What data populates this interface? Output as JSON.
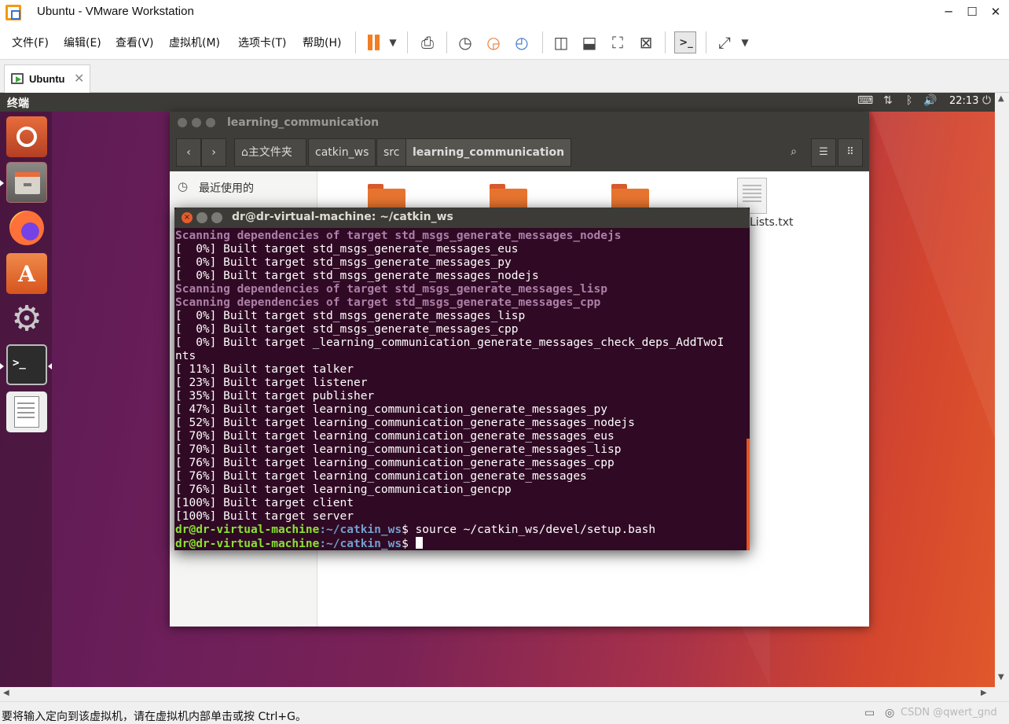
{
  "window": {
    "title": "Ubuntu - VMware Workstation",
    "controls": {
      "minimize": "─",
      "maximize": "☐",
      "close": "✕"
    }
  },
  "menubar": {
    "items": [
      "文件(F)",
      "编辑(E)",
      "查看(V)",
      "虚拟机(M)",
      "选项卡(T)",
      "帮助(H)"
    ]
  },
  "toolbar": {
    "icons": [
      "pause-icon",
      "dropdown-icon",
      "send-ctrl-alt-del-icon",
      "snapshot-icon",
      "revert-snapshot-icon",
      "snapshot-manager-icon",
      "show-library-icon",
      "thumbnail-icon",
      "full-screen-icon",
      "unity-icon",
      "console-view-icon",
      "stretch-icon",
      "dropdown-icon"
    ],
    "accent": "#f07e22"
  },
  "tabs": [
    {
      "label": "Ubuntu",
      "close": "✕"
    }
  ],
  "ubuntu": {
    "topbar": {
      "app_name": "终端",
      "clock": "22:13"
    },
    "launcher": [
      "ubuntu-icon",
      "file-manager-icon",
      "firefox-icon",
      "software-center-icon",
      "system-settings-icon",
      "terminal-icon",
      "text-editor-icon"
    ],
    "nautilus": {
      "title": "learning_communication",
      "breadcrumb": [
        "主文件夹",
        "catkin_ws",
        "src",
        "learning_communication"
      ],
      "sidebar": [
        "最近使用的"
      ],
      "file_label": "Lists.txt"
    },
    "terminal": {
      "title": "dr@dr-virtual-machine: ~/catkin_ws",
      "lines": [
        {
          "type": "scan",
          "text": "Scanning dependencies of target std_msgs_generate_messages_nodejs"
        },
        {
          "type": "out",
          "text": "[  0%] Built target std_msgs_generate_messages_eus"
        },
        {
          "type": "out",
          "text": "[  0%] Built target std_msgs_generate_messages_py"
        },
        {
          "type": "out",
          "text": "[  0%] Built target std_msgs_generate_messages_nodejs"
        },
        {
          "type": "scan",
          "text": "Scanning dependencies of target std_msgs_generate_messages_lisp"
        },
        {
          "type": "scan",
          "text": "Scanning dependencies of target std_msgs_generate_messages_cpp"
        },
        {
          "type": "out",
          "text": "[  0%] Built target std_msgs_generate_messages_lisp"
        },
        {
          "type": "out",
          "text": "[  0%] Built target std_msgs_generate_messages_cpp"
        },
        {
          "type": "out",
          "text": "[  0%] Built target _learning_communication_generate_messages_check_deps_AddTwoI"
        },
        {
          "type": "out",
          "text": "nts"
        },
        {
          "type": "out",
          "text": "[ 11%] Built target talker"
        },
        {
          "type": "out",
          "text": "[ 23%] Built target listener"
        },
        {
          "type": "out",
          "text": "[ 35%] Built target publisher"
        },
        {
          "type": "out",
          "text": "[ 47%] Built target learning_communication_generate_messages_py"
        },
        {
          "type": "out",
          "text": "[ 52%] Built target learning_communication_generate_messages_nodejs"
        },
        {
          "type": "out",
          "text": "[ 70%] Built target learning_communication_generate_messages_eus"
        },
        {
          "type": "out",
          "text": "[ 70%] Built target learning_communication_generate_messages_lisp"
        },
        {
          "type": "out",
          "text": "[ 76%] Built target learning_communication_generate_messages_cpp"
        },
        {
          "type": "out",
          "text": "[ 76%] Built target learning_communication_generate_messages"
        },
        {
          "type": "out",
          "text": "[ 76%] Built target learning_communication_gencpp"
        },
        {
          "type": "out",
          "text": "[100%] Built target client"
        },
        {
          "type": "out",
          "text": "[100%] Built target server"
        }
      ],
      "prompt_user": "dr@dr-virtual-machine",
      "prompt_path": ":~/catkin_ws",
      "prompt_sym": "$",
      "command1": " source ~/catkin_ws/devel/setup.bash",
      "command2": " "
    }
  },
  "statusbar": {
    "message": "要将输入定向到该虚拟机，请在虚拟机内部单击或按 Ctrl+G。",
    "watermark": "CSDN @qwert_gnd"
  }
}
